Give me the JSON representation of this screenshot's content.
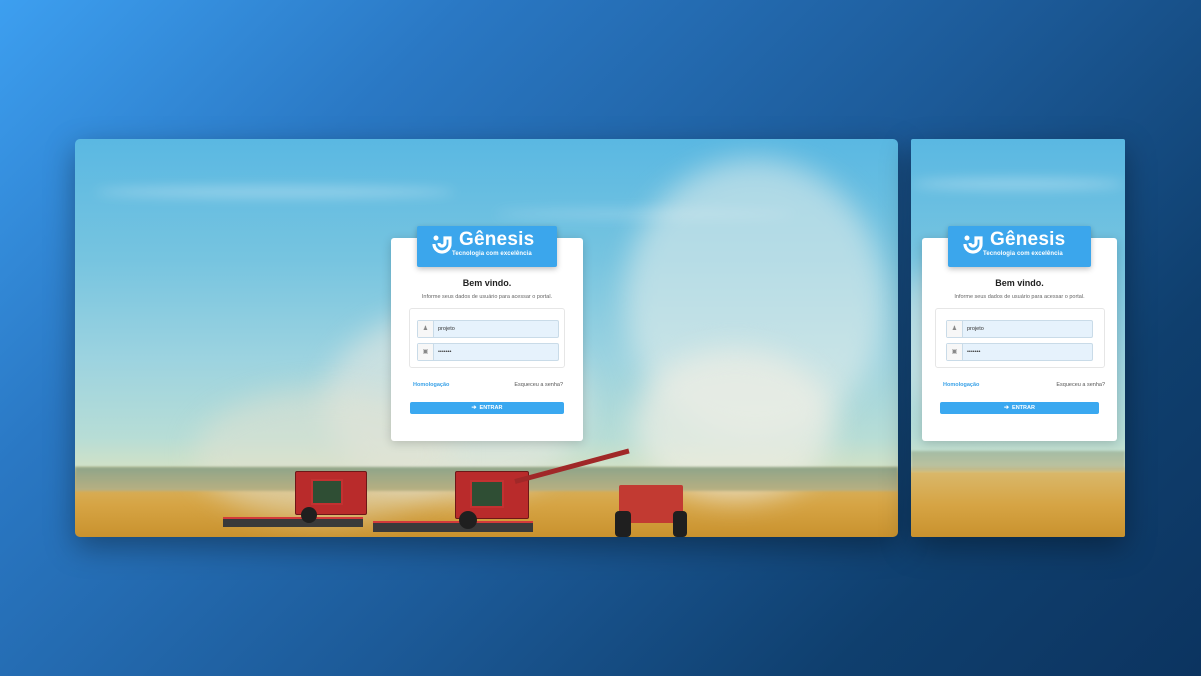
{
  "brand": {
    "name": "Gênesis",
    "tagline": "Tecnologia com excelência",
    "color": "#3ba6ec"
  },
  "login": {
    "welcome": "Bem vindo.",
    "subtitle": "Informe seus dados de usuário para acessar o portal.",
    "username_value": "projeto",
    "password_value": "•••••••",
    "username_icon": "user-icon",
    "password_icon": "lock-icon",
    "environment_link": "Homologação",
    "forgot_link": "Esqueceu a senha?",
    "submit_label": "ENTRAR",
    "submit_icon": "sign-in-icon"
  },
  "colors": {
    "accent": "#3aa8f0",
    "link": "#3aa2e8",
    "field_bg": "#e6f2fc"
  }
}
